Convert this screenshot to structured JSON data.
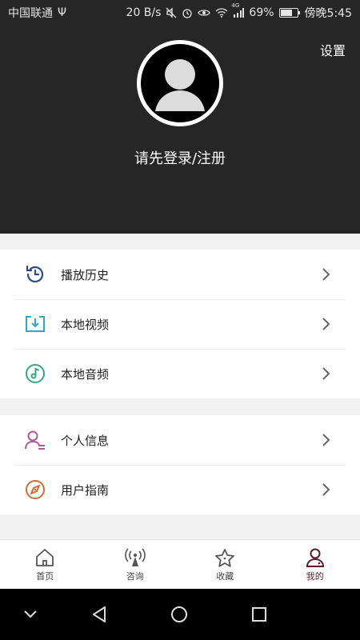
{
  "status_bar": {
    "carrier": "中国联通",
    "usb_symbol": "Ψ",
    "speed": "20 B/s",
    "network_tag": "4G",
    "battery": "69%",
    "time": "傍晚5:45"
  },
  "header": {
    "settings": "设置",
    "login_prompt": "请先登录/注册"
  },
  "menu_group_1": [
    {
      "label": "播放历史",
      "icon": "clock-history-icon"
    },
    {
      "label": "本地视频",
      "icon": "download-video-icon"
    },
    {
      "label": "本地音频",
      "icon": "music-note-icon"
    }
  ],
  "menu_group_2": [
    {
      "label": "个人信息",
      "icon": "user-info-icon"
    },
    {
      "label": "用户指南",
      "icon": "compass-icon"
    }
  ],
  "bottom_nav": [
    {
      "label": "首页",
      "icon": "home-icon"
    },
    {
      "label": "咨询",
      "icon": "broadcast-icon"
    },
    {
      "label": "收藏",
      "icon": "star-icon"
    },
    {
      "label": "我的",
      "icon": "profile-icon",
      "active": true
    }
  ],
  "colors": {
    "header_bg": "#262626",
    "history": "#2d4a8a",
    "video": "#2ea8c9",
    "audio": "#35a77c",
    "user_info": "#b15a9a",
    "guide": "#d46a35",
    "active_tab": "#5a1f2b"
  }
}
